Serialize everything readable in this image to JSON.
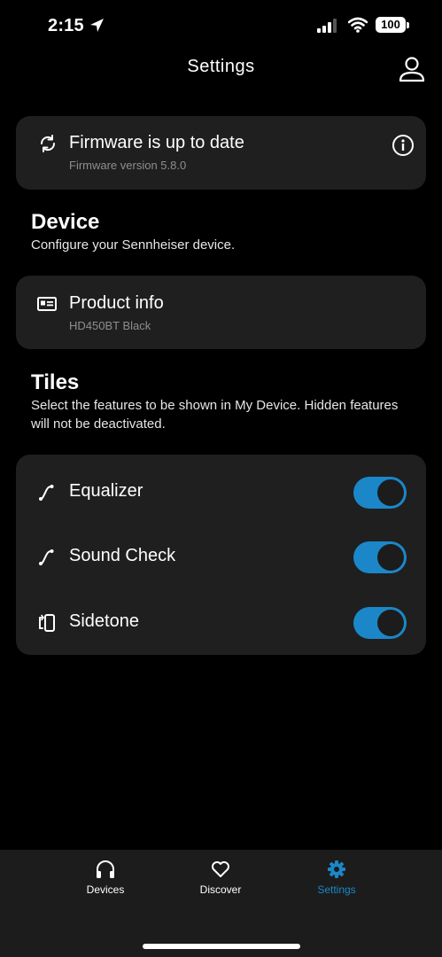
{
  "status_bar": {
    "time": "2:15",
    "battery": "100"
  },
  "header": {
    "title": "Settings",
    "profile_icon": "person-icon"
  },
  "firmware": {
    "title": "Firmware is up to date",
    "subtitle": "Firmware version 5.8.0",
    "icon": "sync-icon",
    "info_icon": "info-icon"
  },
  "device": {
    "heading": "Device",
    "description": "Configure your Sennheiser device.",
    "product_info": {
      "title": "Product info",
      "subtitle": "HD450BT Black",
      "icon": "product-card-icon"
    }
  },
  "tiles": {
    "heading": "Tiles",
    "description": "Select the features to be shown in My Device. Hidden features will not be deactivated.",
    "items": [
      {
        "label": "Equalizer",
        "enabled": true,
        "icon": "curve-icon"
      },
      {
        "label": "Sound Check",
        "enabled": true,
        "icon": "curve-icon"
      },
      {
        "label": "Sidetone",
        "enabled": true,
        "icon": "sidetone-icon"
      }
    ]
  },
  "tab_bar": {
    "tabs": [
      {
        "label": "Devices",
        "icon": "headphones-icon",
        "active": false
      },
      {
        "label": "Discover",
        "icon": "heart-icon",
        "active": false
      },
      {
        "label": "Settings",
        "icon": "gear-icon",
        "active": true
      }
    ]
  },
  "colors": {
    "accent": "#1b87c9",
    "card": "#1f1f1f",
    "background": "#000000",
    "tab_bar": "#1c1c1c",
    "muted_text": "#8e8e8e"
  }
}
